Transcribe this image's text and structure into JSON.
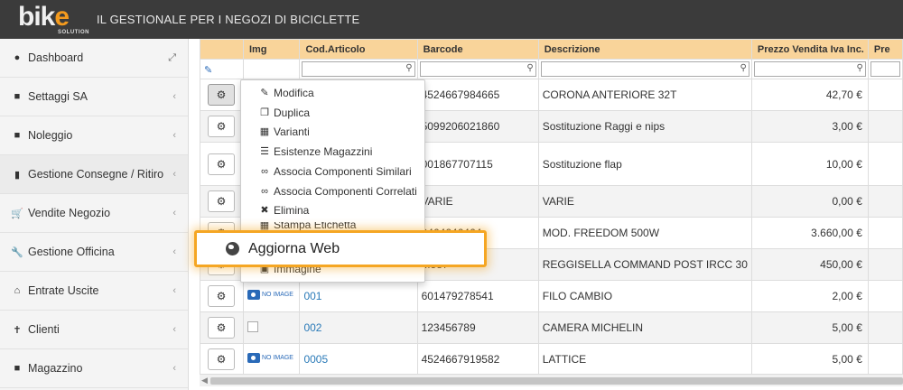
{
  "header": {
    "logo_text": "bike",
    "logo_sub": "SOLUTION",
    "tagline": "IL GESTIONALE PER I NEGOZI DI BICICLETTE"
  },
  "sidebar": {
    "items": [
      {
        "label": "Dashboard",
        "icon": "dashboard-icon"
      },
      {
        "label": "Settaggi SA",
        "icon": "book-icon"
      },
      {
        "label": "Noleggio",
        "icon": "book-icon"
      },
      {
        "label": "Gestione Consegne / Ritiro",
        "icon": "book-open-icon"
      },
      {
        "label": "Vendite Negozio",
        "icon": "cart-icon"
      },
      {
        "label": "Gestione Officina",
        "icon": "wrench-icon"
      },
      {
        "label": "Entrate Uscite",
        "icon": "bank-icon"
      },
      {
        "label": "Clienti",
        "icon": "person-icon"
      },
      {
        "label": "Magazzino",
        "icon": "book-icon"
      }
    ]
  },
  "table": {
    "columns": [
      "",
      "Img",
      "Cod.Articolo",
      "Barcode",
      "Descrizione",
      "Prezzo Vendita Iva Inc.",
      "Pre"
    ],
    "rows": [
      {
        "img": "",
        "code": "",
        "barcode": "4524667984665",
        "desc": "CORONA ANTERIORE 32T",
        "price": "42,70 €"
      },
      {
        "img": "",
        "code": "",
        "barcode": "5099206021860",
        "desc": "Sostituzione Raggi e nips",
        "price": "3,00 €"
      },
      {
        "img": "",
        "code": "",
        "barcode": "001867707115",
        "desc": "Sostituzione flap",
        "price": "10,00 €"
      },
      {
        "img": "",
        "code": "",
        "barcode": "VARIE",
        "desc": "VARIE",
        "price": "0,00 €"
      },
      {
        "img": "",
        "code": "",
        "barcode": "0464646464",
        "desc": "MOD. FREEDOM 500W",
        "price": "3.660,00 €"
      },
      {
        "img": "",
        "code": "",
        "barcode": "...587",
        "desc": "REGGISELLA COMMAND POST IRCC 30",
        "price": "450,00 €"
      },
      {
        "img": "NO IMAGE",
        "code": "001",
        "barcode": "601479278541",
        "desc": "FILO CAMBIO",
        "price": "2,00 €"
      },
      {
        "img": "broken",
        "code": "002",
        "barcode": "123456789",
        "desc": "CAMERA MICHELIN",
        "price": "5,00 €"
      },
      {
        "img": "NO IMAGE",
        "code": "0005",
        "barcode": "4524667919582",
        "desc": "LATTICE",
        "price": "5,00 €"
      }
    ]
  },
  "menu": {
    "items": [
      {
        "label": "Modifica",
        "icon": "edit-icon"
      },
      {
        "label": "Duplica",
        "icon": "copy-icon"
      },
      {
        "label": "Varianti",
        "icon": "table-icon"
      },
      {
        "label": "Esistenze Magazzini",
        "icon": "list-icon"
      },
      {
        "label": "Associa Componenti Similari",
        "icon": "link-icon"
      },
      {
        "label": "Associa Componenti Correlati",
        "icon": "link-icon"
      },
      {
        "label": "Elimina",
        "icon": "times-icon"
      },
      {
        "label": "Stampa Etichetta",
        "icon": "barcode-icon"
      },
      {
        "label": "Immagine",
        "icon": "image-icon"
      }
    ],
    "highlight": {
      "label": "Aggiorna Web",
      "icon": "globe-icon"
    }
  },
  "colors": {
    "accent": "#f5a623",
    "header_bg": "#3b3b3b",
    "table_header": "#f9d49a",
    "link": "#2a7ab8"
  }
}
